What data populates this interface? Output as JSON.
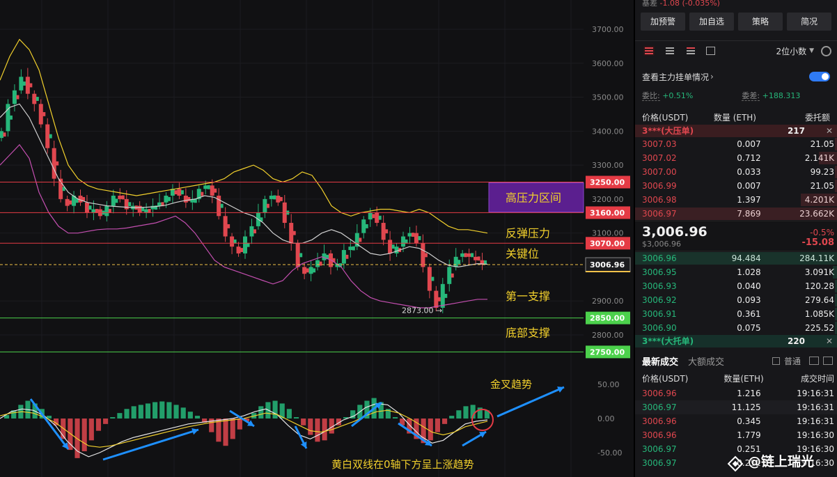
{
  "header": {
    "stats_label": "基差",
    "stats_value": "-1.08 (-0.035%)"
  },
  "buttons": [
    "加预警",
    "加自选",
    "策略",
    "简况"
  ],
  "decimal_selector": "2位小数",
  "view_main_orders": "查看主力挂单情况",
  "ratio": {
    "label": "委比:",
    "value": "+0.51%"
  },
  "diff": {
    "label": "委差:",
    "value": "+188.313"
  },
  "book_headers": [
    "价格(USDT)",
    "数量 (ETH)",
    "委托额"
  ],
  "big_ask": {
    "name": "3***(大压单)",
    "qty": "217"
  },
  "asks": [
    {
      "price": "3007.03",
      "qty": "0.007",
      "amount": "21.05",
      "depth": 0.01
    },
    {
      "price": "3007.02",
      "qty": "0.712",
      "amount": "2.141K",
      "depth": 0.09
    },
    {
      "price": "3007.00",
      "qty": "0.033",
      "amount": "99.23",
      "depth": 0.01
    },
    {
      "price": "3006.99",
      "qty": "0.007",
      "amount": "21.05",
      "depth": 0.01
    },
    {
      "price": "3006.98",
      "qty": "1.397",
      "amount": "4.201K",
      "depth": 0.18
    },
    {
      "price": "3006.97",
      "qty": "7.869",
      "amount": "23.662K",
      "depth": 1.0
    }
  ],
  "mid": {
    "price": "3,006.96",
    "sub": "$3,006.96",
    "pct": "-0.5%",
    "chg": "-15.08"
  },
  "bids": [
    {
      "price": "3006.96",
      "qty": "94.484",
      "amount": "284.11K",
      "depth": 1.0
    },
    {
      "price": "3006.95",
      "qty": "1.028",
      "amount": "3.091K",
      "depth": 0.02
    },
    {
      "price": "3006.93",
      "qty": "0.040",
      "amount": "120.28",
      "depth": 0.01
    },
    {
      "price": "3006.92",
      "qty": "0.093",
      "amount": "279.64",
      "depth": 0.01
    },
    {
      "price": "3006.91",
      "qty": "0.361",
      "amount": "1.085K",
      "depth": 0.01
    },
    {
      "price": "3006.90",
      "qty": "0.075",
      "amount": "225.52",
      "depth": 0.01
    }
  ],
  "big_bid": {
    "name": "3***(大托单)",
    "qty": "220"
  },
  "trades_tabs": {
    "active": "最新成交",
    "inactive": "大额成交",
    "checkbox": "普通"
  },
  "trade_headers": [
    "价格(USDT)",
    "数量(ETH)",
    "成交时间"
  ],
  "trades": [
    {
      "price": "3006.96",
      "qty": "1.216",
      "time": "19:16:31",
      "dir": "down"
    },
    {
      "price": "3006.97",
      "qty": "11.125",
      "time": "19:16:31",
      "dir": "up"
    },
    {
      "price": "3006.96",
      "qty": "0.345",
      "time": "19:16:31",
      "dir": "down"
    },
    {
      "price": "3006.96",
      "qty": "1.779",
      "time": "19:16:30",
      "dir": "down"
    },
    {
      "price": "3006.97",
      "qty": "0.251",
      "time": "19:16:30",
      "dir": "up"
    },
    {
      "price": "3006.97",
      "qty": "0.251",
      "time": "19:16:30",
      "dir": "up"
    }
  ],
  "watermark": "@链上瑞光",
  "colors": {
    "up": "#26b77a",
    "down": "#e0474f",
    "yellow": "#f2d02c",
    "white_line": "#d8d8d8",
    "pink": "#c44fb0",
    "blue_arrow": "#1e90ff"
  },
  "chart_data": {
    "type": "candlestick",
    "y_ticks": [
      3700,
      3600,
      3500,
      3400,
      3300,
      3200,
      3100,
      3000,
      2900,
      2800
    ],
    "y_tick_labels": [
      "3700.00",
      "3600.00",
      "3500.00",
      "3400.00",
      "3300.00",
      "3200.00",
      "3100.00",
      "3000.00",
      "2900.00",
      "2800.00"
    ],
    "ylim": [
      2780,
      3740
    ],
    "close_path": [
      3400,
      3480,
      3520,
      3560,
      3510,
      3480,
      3420,
      3350,
      3260,
      3200,
      3180,
      3210,
      3190,
      3160,
      3170,
      3150,
      3180,
      3210,
      3200,
      3170,
      3180,
      3160,
      3170,
      3180,
      3190,
      3210,
      3230,
      3210,
      3190,
      3200,
      3230,
      3240,
      3210,
      3150,
      3090,
      3060,
      3040,
      3090,
      3120,
      3160,
      3200,
      3210,
      3190,
      3130,
      3070,
      3000,
      2980,
      3000,
      3020,
      3040,
      3000,
      3010,
      3050,
      3060,
      3100,
      3140,
      3160,
      3130,
      3080,
      3040,
      3060,
      3090,
      3100,
      3070,
      3000,
      2930,
      2880,
      2950,
      3000,
      3030,
      3040,
      3030,
      3020,
      3007
    ],
    "bollinger_upper": [
      3550,
      3620,
      3670,
      3640,
      3580,
      3480,
      3380,
      3300,
      3260,
      3240,
      3230,
      3225,
      3220,
      3215,
      3210,
      3215,
      3220,
      3225,
      3230,
      3235,
      3240,
      3245,
      3250,
      3260,
      3280,
      3290,
      3300,
      3285,
      3260,
      3250,
      3260,
      3280,
      3270,
      3230,
      3180,
      3160,
      3150,
      3160,
      3165,
      3170,
      3170,
      3165,
      3160,
      3170,
      3160,
      3140,
      3120,
      3110,
      3110,
      3105,
      3100
    ],
    "bollinger_mid": [
      3440,
      3470,
      3480,
      3440,
      3380,
      3320,
      3260,
      3220,
      3200,
      3190,
      3185,
      3180,
      3178,
      3176,
      3175,
      3176,
      3178,
      3182,
      3190,
      3196,
      3200,
      3210,
      3205,
      3190,
      3175,
      3160,
      3150,
      3130,
      3100,
      3080,
      3070,
      3070,
      3080,
      3100,
      3110,
      3100,
      3080,
      3060,
      3040,
      3035,
      3040,
      3050,
      3060,
      3055,
      3040,
      3020,
      3005,
      3000,
      3005,
      3010,
      3008
    ],
    "bollinger_lower": [
      3300,
      3330,
      3360,
      3320,
      3220,
      3160,
      3120,
      3100,
      3100,
      3105,
      3110,
      3112,
      3112,
      3115,
      3120,
      3125,
      3130,
      3140,
      3150,
      3130,
      3100,
      3060,
      3020,
      3000,
      2990,
      2980,
      2970,
      2960,
      2950,
      2960,
      2990,
      3010,
      3020,
      3030,
      3020,
      3000,
      2960,
      2930,
      2910,
      2900,
      2895,
      2890,
      2885,
      2880,
      2880,
      2885,
      2890,
      2895,
      2900,
      2905,
      2905
    ],
    "current_price": 3006.96,
    "current_price_label": "3006.96",
    "low_marker": {
      "value": 2873,
      "label": "2873.00"
    },
    "levels": [
      {
        "value": 3250,
        "label": "3250.00",
        "kind": "resistance"
      },
      {
        "value": 3160,
        "label": "3160.00",
        "kind": "resistance"
      },
      {
        "value": 3070,
        "label": "3070.00",
        "kind": "resistance"
      },
      {
        "value": 2850,
        "label": "2850.00",
        "kind": "support"
      },
      {
        "value": 2750,
        "label": "2750.00",
        "kind": "support"
      }
    ],
    "annotations": [
      {
        "text": "高压力区间",
        "value": 3205,
        "box": true
      },
      {
        "text": "反弹压力",
        "value": 3100
      },
      {
        "text": "关键位",
        "value": 3040
      },
      {
        "text": "第一支撑",
        "value": 2915
      },
      {
        "text": "底部支撑",
        "value": 2807
      }
    ],
    "macd": {
      "y_ticks": [
        50,
        0,
        -50
      ],
      "y_tick_labels": [
        "50.00",
        "0.00",
        "-50.00"
      ],
      "ylim": [
        -60,
        60
      ],
      "hist": [
        5,
        12,
        20,
        26,
        22,
        14,
        4,
        -10,
        -30,
        -46,
        -58,
        -48,
        -32,
        -18,
        -8,
        2,
        8,
        14,
        18,
        20,
        22,
        24,
        25,
        24,
        20,
        16,
        10,
        4,
        -6,
        -20,
        -34,
        -40,
        -30,
        -16,
        -4,
        8,
        18,
        24,
        26,
        22,
        14,
        2,
        -10,
        -24,
        -34,
        -32,
        -22,
        -10,
        2,
        12,
        20,
        26,
        30,
        24,
        14,
        2,
        -10,
        -22,
        -30,
        -36,
        -32,
        -20,
        -8,
        4,
        12,
        18,
        20,
        16,
        12
      ],
      "dif": [
        0,
        10,
        14,
        12,
        4,
        -10,
        -32,
        -48,
        -56,
        -50,
        -42,
        -34,
        -28,
        -24,
        -20,
        -16,
        -12,
        -8,
        -6,
        -4,
        -2,
        0,
        4,
        10,
        14,
        6,
        -10,
        -24,
        -30,
        -22,
        -12,
        -2,
        4,
        16,
        22,
        20,
        8,
        -10,
        -26,
        -36,
        -32,
        -20,
        -8,
        -4,
        -2
      ],
      "dea": [
        4,
        8,
        10,
        8,
        2,
        -6,
        -18,
        -30,
        -40,
        -42,
        -40,
        -36,
        -32,
        -28,
        -24,
        -20,
        -16,
        -12,
        -9,
        -6,
        -4,
        -2,
        0,
        4,
        8,
        6,
        -2,
        -10,
        -18,
        -20,
        -16,
        -10,
        -4,
        4,
        10,
        12,
        8,
        0,
        -10,
        -20,
        -24,
        -20,
        -12,
        -8,
        -4
      ],
      "annotations": [
        {
          "text": "金叉趋势"
        },
        {
          "text": "黄白双线在0轴下方呈上涨趋势"
        }
      ]
    }
  }
}
